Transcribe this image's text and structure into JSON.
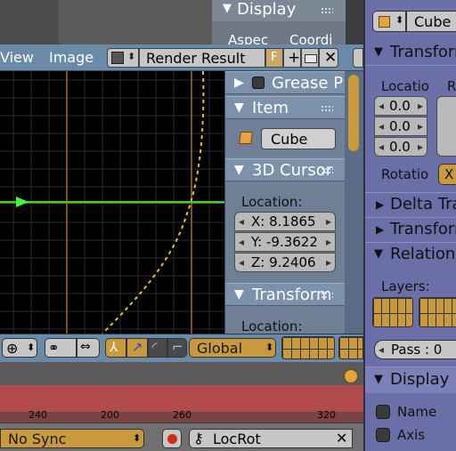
{
  "top_panel": {
    "display_header": "Display",
    "aspect_label": "Aspec",
    "coords_label": "Coordi"
  },
  "image_editor": {
    "menu_view": "View",
    "menu_image": "Image",
    "image_name": "Render Result",
    "fake_user": "F"
  },
  "npanel": {
    "grease_header": "Grease P",
    "item_header": "Item",
    "item_name": "Cube",
    "cursor_header": "3D Cursor",
    "location_label": "Location:",
    "cursor_x": "X:  8.1865",
    "cursor_y": "Y:  -9.3622",
    "cursor_z": "Z:  9.2406",
    "transform_header": "Transform",
    "transform_location_label": "Location:"
  },
  "view3d_header": {
    "orientation": "Global"
  },
  "timeline": {
    "ticks": [
      "240",
      "200",
      "260",
      "320"
    ],
    "sync_mode": "No Sync",
    "keying_set": "LocRot"
  },
  "properties": {
    "object_name": "Cube",
    "transform_header": "Transform",
    "location_label": "Locatio",
    "rotation_label_col": "R",
    "loc_values": [
      "0.0",
      "0.0",
      "0.0"
    ],
    "rotation_mode_label": "Rotatio",
    "rotation_mode_value": "X",
    "delta_header": "Delta Tra",
    "transform_locks_header": "Transform",
    "relations_header": "Relations",
    "layers_label": "Layers:",
    "pass_index": "Pass : 0",
    "display_header": "Display",
    "name_checkbox": "Name",
    "axis_checkbox": "Axis"
  },
  "colors": {
    "accent_orange": "#c89a3c",
    "cursor_green": "#33ff33",
    "panel_blue": "#6a8aa8",
    "props_purple": "#6a6fa8"
  }
}
